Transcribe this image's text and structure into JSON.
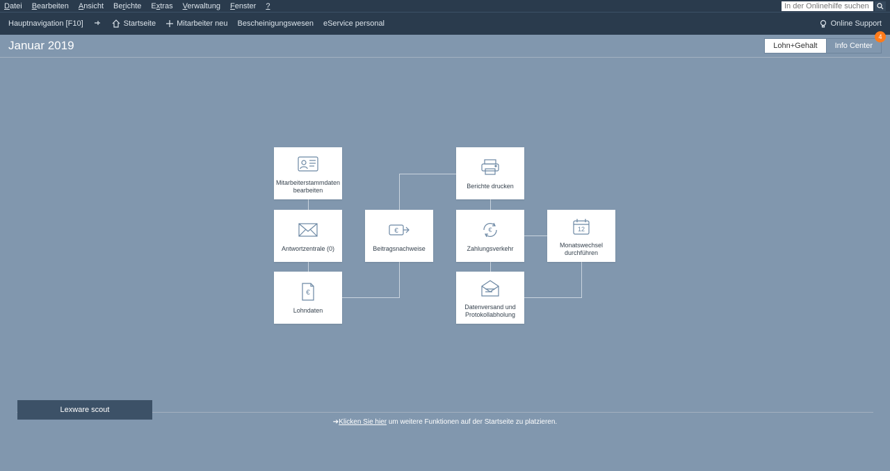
{
  "menu": {
    "items": [
      "Datei",
      "Bearbeiten",
      "Ansicht",
      "Berichte",
      "Extras",
      "Verwaltung",
      "Fenster",
      "?"
    ]
  },
  "search": {
    "placeholder": "In der Onlinehilfe suchen"
  },
  "toolbar": {
    "nav_label": "Hauptnavigation [F10]",
    "home": "Startseite",
    "new_employee": "Mitarbeiter neu",
    "cert": "Bescheinigungswesen",
    "eservice": "eService personal",
    "support": "Online Support"
  },
  "header": {
    "title": "Januar 2019"
  },
  "tabs": {
    "t0": "Lohn+Gehalt",
    "t1": "Info Center",
    "badge": "4"
  },
  "cards": {
    "c0": "Mitarbeiterstammdaten bearbeiten",
    "c1": "Berichte drucken",
    "c2": "Antwortzentrale (0)",
    "c3": "Beitragsnachweise",
    "c4": "Zahlungsverkehr",
    "c5": "Monatswechsel durchführen",
    "c6": "Lohndaten",
    "c7": "Datenversand und Protokollabholung"
  },
  "footer": {
    "link": "Klicken Sie hier",
    "rest": " um weitere Funktionen auf der Startseite zu platzieren."
  },
  "scout": {
    "label": "Lexware scout"
  }
}
